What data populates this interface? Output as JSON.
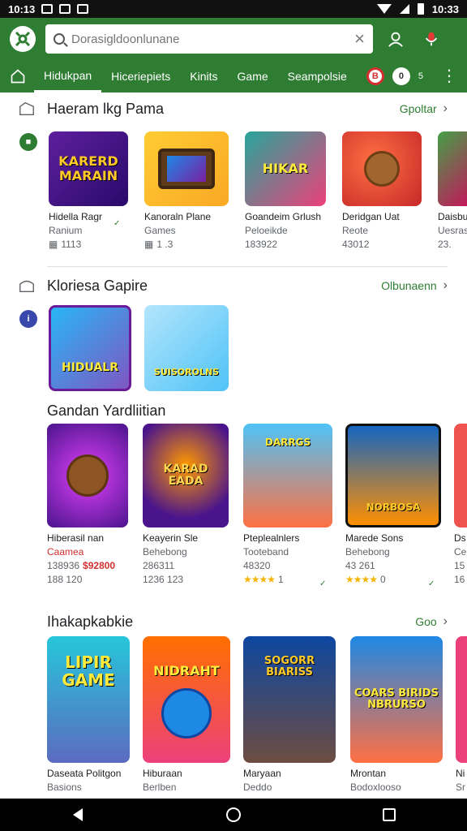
{
  "status": {
    "time": "10:13",
    "clock_right": "10:33"
  },
  "search": {
    "placeholder": "Dorasigldoonlunane"
  },
  "tabs": [
    {
      "label": "Hidukpan"
    },
    {
      "label": "Hiceriepiets"
    },
    {
      "label": "Kinits"
    },
    {
      "label": "Game"
    },
    {
      "label": "Seampolsie"
    }
  ],
  "tab_badges": {
    "badge_red": "B",
    "badge_dark": "0",
    "badge_text": "5"
  },
  "sections": [
    {
      "title": "Haeram lkg Pama",
      "more": "Gpoltar",
      "items": [
        {
          "thumb": "KARERD MARAIN",
          "name": "Hidella Ragr",
          "line2": "Ranium",
          "line3": "1113"
        },
        {
          "thumb": "",
          "name": "Kanoraln Plane",
          "line2": "Games",
          "line3": "1 .3"
        },
        {
          "thumb": "HIKAR",
          "name": "Goandeim Grlush",
          "line2": "Peloeikde",
          "line3": "183922"
        },
        {
          "thumb": "",
          "name": "Deridgan Uat",
          "line2": "Reote",
          "line3": "43012"
        },
        {
          "thumb": "",
          "name": "Daisbu",
          "line2": "Uesras",
          "line3": "23."
        }
      ]
    },
    {
      "title": "Kloriesa Gapire",
      "more": "Olbunaenn",
      "items": [
        {
          "thumb": "HIDUALR"
        },
        {
          "thumb": "SUISOROLNS"
        }
      ]
    },
    {
      "title": "Gandan Yardliitian",
      "items": [
        {
          "thumb": "",
          "name": "Hiberasil nan",
          "line2": "Caamea",
          "line3": "138936",
          "line3b": "$92800",
          "line4": "188 120"
        },
        {
          "thumb": "KARAD EADA",
          "name": "Keayerin Sle",
          "line2": "Behebong",
          "line3": "286311",
          "line4": "1236 123"
        },
        {
          "thumb": "DARRGS",
          "name": "Pteplealnlers",
          "line2": "Tooteband",
          "line3": "48320",
          "line4": "1"
        },
        {
          "thumb": "NORBOSA",
          "name": "Marede Sons",
          "line2": "Behebong",
          "line3": "43 261",
          "line4": "0"
        },
        {
          "thumb": "",
          "name": "Ds",
          "line2": "Ce",
          "line3": "15",
          "line4": "16"
        }
      ]
    },
    {
      "title": "Ihakapkabkie",
      "more": "Goo",
      "items": [
        {
          "thumb": "LIPIR GAME",
          "name": "Daseata Politgon",
          "line2": "Basions"
        },
        {
          "thumb": "NIDRAHT",
          "name": "Hiburaan",
          "line2": "Berlben"
        },
        {
          "thumb": "SOGORR BIARISS",
          "name": "Maryaan",
          "line2": "Deddo"
        },
        {
          "thumb": "COARS BIRIDS NBRURSO",
          "name": "Mrontan",
          "line2": "Bodoxlooso"
        },
        {
          "thumb": "",
          "name": "Ni",
          "line2": "Sr"
        }
      ]
    }
  ],
  "colors": {
    "accent": "#2e7d32",
    "star": "#f4b400",
    "price": "#d32f2f"
  }
}
